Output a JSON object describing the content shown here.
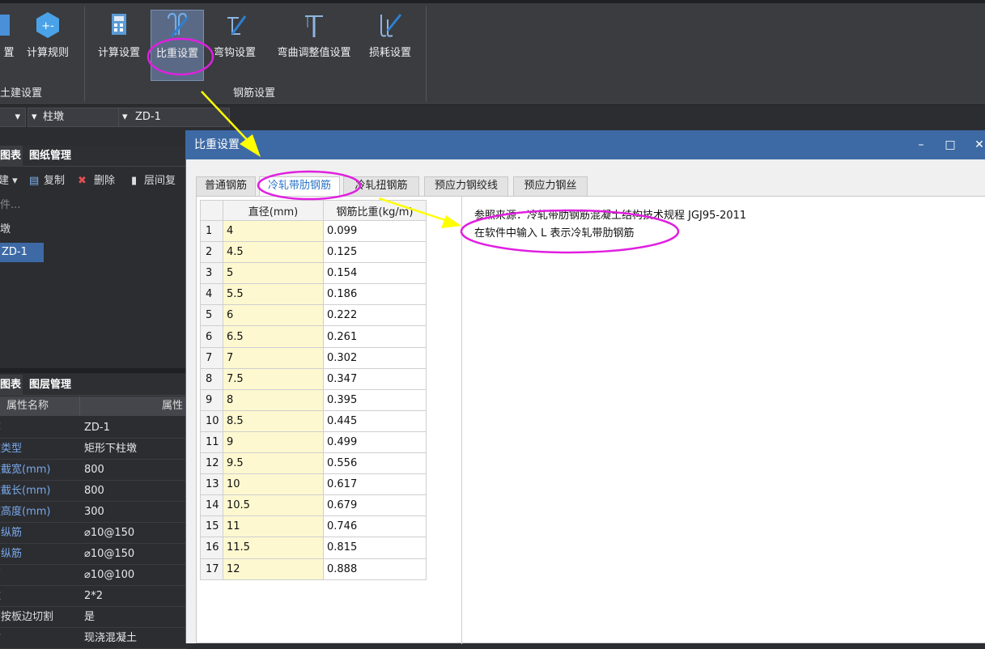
{
  "ribbon": {
    "buttons": [
      {
        "label": "置",
        "icon": "settings-icon"
      },
      {
        "label": "计算规则",
        "icon": "calc-rule-icon"
      },
      {
        "label": "计算设置",
        "icon": "calculator-icon"
      },
      {
        "label": "比重设置",
        "icon": "rebar-weight-icon"
      },
      {
        "label": "弯钩设置",
        "icon": "hook-icon"
      },
      {
        "label": "弯曲调整值设置",
        "icon": "bend-adjust-icon"
      },
      {
        "label": "损耗设置",
        "icon": "loss-icon"
      }
    ],
    "groups": {
      "civil": "土建设置",
      "rebar": "钢筋设置"
    }
  },
  "selectors": {
    "first": "柱墩",
    "second": "ZD-1"
  },
  "left_top": {
    "tabs": [
      "图表",
      "图纸管理"
    ],
    "tools": {
      "new": "建",
      "copy": "复制",
      "delete": "删除",
      "floor_copy": "层间复"
    },
    "search": "件...",
    "tree": [
      "墩",
      "ZD-1"
    ]
  },
  "left_bottom": {
    "tabs": [
      "图表",
      "图层管理"
    ],
    "header": {
      "name": "属性名称",
      "value": "属性"
    },
    "props": [
      {
        "k": "称",
        "v": "ZD-1"
      },
      {
        "k": "墩类型",
        "v": "矩形下柱墩"
      },
      {
        "k": "墩截宽(mm)",
        "v": "800"
      },
      {
        "k": "墩截长(mm)",
        "v": "800"
      },
      {
        "k": "墩高度(mm)",
        "v": "300"
      },
      {
        "k": "向纵筋",
        "v": "⌀10@150"
      },
      {
        "k": "向纵筋",
        "v": "⌀10@150"
      },
      {
        "k": "筋",
        "v": "⌀10@100"
      },
      {
        "k": "数",
        "v": "2*2"
      },
      {
        "k": "否按板边切割",
        "v": "是"
      },
      {
        "k": "质",
        "v": "现浇混凝土"
      }
    ]
  },
  "dialog": {
    "title": "比重设置",
    "controls": {
      "min": "–",
      "max": "□",
      "close": "✕"
    },
    "tabs": [
      "普通钢筋",
      "冷轧带肋钢筋",
      "冷轧扭钢筋",
      "预应力钢绞线",
      "预应力钢丝"
    ],
    "active_tab": 1,
    "table": {
      "headers": [
        "直径(mm)",
        "钢筋比重(kg/m)"
      ],
      "rows": [
        [
          "1",
          "4",
          "0.099"
        ],
        [
          "2",
          "4.5",
          "0.125"
        ],
        [
          "3",
          "5",
          "0.154"
        ],
        [
          "4",
          "5.5",
          "0.186"
        ],
        [
          "5",
          "6",
          "0.222"
        ],
        [
          "6",
          "6.5",
          "0.261"
        ],
        [
          "7",
          "7",
          "0.302"
        ],
        [
          "8",
          "7.5",
          "0.347"
        ],
        [
          "9",
          "8",
          "0.395"
        ],
        [
          "10",
          "8.5",
          "0.445"
        ],
        [
          "11",
          "9",
          "0.499"
        ],
        [
          "12",
          "9.5",
          "0.556"
        ],
        [
          "13",
          "10",
          "0.617"
        ],
        [
          "14",
          "10.5",
          "0.679"
        ],
        [
          "15",
          "11",
          "0.746"
        ],
        [
          "16",
          "11.5",
          "0.815"
        ],
        [
          "17",
          "12",
          "0.888"
        ]
      ]
    },
    "note_source": "参照来源：冷轧带肋钢筋混凝土结构技术规程 JGJ95-2011",
    "note_input": "在软件中输入 L 表示冷轧带肋钢筋"
  },
  "colors": {
    "accent": "#3d6aa5",
    "highlight": "#e020e0",
    "arrow": "#ffff00",
    "cell_yellow": "#fdf8d0"
  }
}
